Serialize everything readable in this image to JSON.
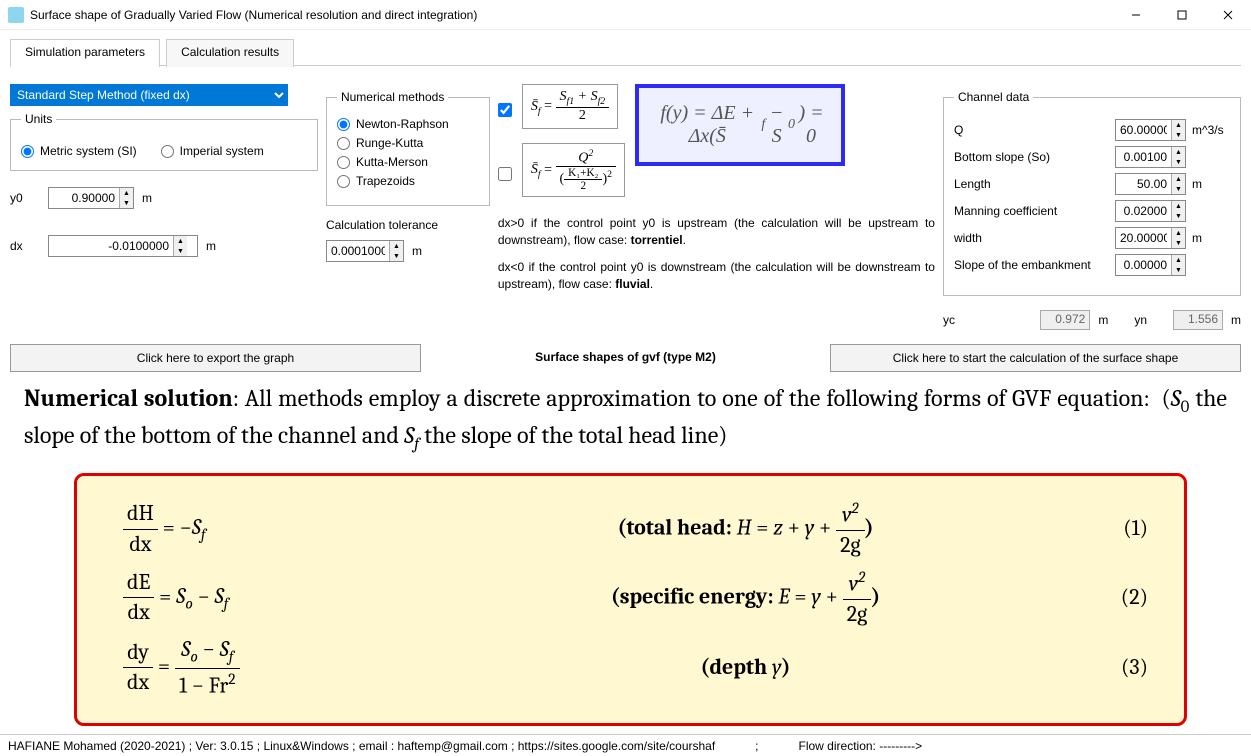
{
  "window": {
    "title": "Surface shape of Gradually Varied Flow (Numerical resolution and direct integration)"
  },
  "tabs": {
    "sim": "Simulation parameters",
    "results": "Calculation results"
  },
  "method_selected": "Standard Step Method (fixed dx)",
  "units": {
    "legend": "Units",
    "metric": "Metric system (SI)",
    "imperial": "Imperial system"
  },
  "num_methods": {
    "legend": "Numerical methods",
    "newton": "Newton-Raphson",
    "runge": "Runge-Kutta",
    "merson": "Kutta-Merson",
    "trap": "Trapezoids"
  },
  "params": {
    "y0_label": "y0",
    "y0_value": "0.90000",
    "y0_unit": "m",
    "dx_label": "dx",
    "dx_value": "-0.0100000",
    "dx_unit": "m",
    "tol_label": "Calculation tolerance",
    "tol_value": "0.0001000",
    "tol_unit": "m"
  },
  "formula1": "S̄_f = (S_f1 + S_f2) / 2",
  "formula2": "S̄_f = Q² / ((K₁+K₂)/2)²",
  "func": "f(y) = ΔE + Δx(S̄_f − S₀) = 0",
  "notes": {
    "line1a": "dx>0 if the control point y0 is upstream (the calculation will be upstream to downstream), flow case: ",
    "line1b": "torrentiel",
    "line2a": "dx<0 if the control point y0 is downstream (the calculation will be downstream to upstream), flow case: ",
    "line2b": "fluvial"
  },
  "channel": {
    "legend": "Channel data",
    "q_label": "Q",
    "q_value": "60.00000",
    "q_unit": "m^3/s",
    "so_label": "Bottom slope (So)",
    "so_value": "0.00100",
    "len_label": "Length",
    "len_value": "50.00",
    "len_unit": "m",
    "mann_label": "Manning coefficient",
    "mann_value": "0.02000",
    "w_label": "width",
    "w_value": "20.00000",
    "w_unit": "m",
    "emb_label": "Slope of the embankment",
    "emb_value": "0.00000",
    "yc_label": "yc",
    "yc_value": "0.972",
    "yc_unit": "m",
    "yn_label": "yn",
    "yn_value": "1.556",
    "yn_unit": "m"
  },
  "buttons": {
    "export": "Click here to export the graph",
    "title": "Surface shapes of gvf (type M2)",
    "start": "Click here to start the calculation of the surface shape"
  },
  "math": {
    "intro_b": "Numerical solution",
    "intro": ": All methods employ a discrete approximation to one of the following forms of GVF equation: (S₀ the slope of the bottom of the channel and S_f the slope of the total head line)",
    "eq1_lhs_n": "dH",
    "eq1_lhs_d": "dx",
    "eq1_rhs": " = −S_f",
    "eq1_desc_a": "(total head: ",
    "eq1_desc_b": "H = z + y + ",
    "eq1_frac_n": "v²",
    "eq1_frac_d": "2g",
    "eq1_desc_c": ")",
    "eq1_num": "(1)",
    "eq2_lhs_n": "dE",
    "eq2_lhs_d": "dx",
    "eq2_rhs": " = Sₒ − S_f",
    "eq2_desc_a": "(specific energy: ",
    "eq2_desc_b": "E = y + ",
    "eq2_desc_c": ")",
    "eq2_num": "(2)",
    "eq3_lhs_n": "dy",
    "eq3_lhs_d": "dx",
    "eq3_rhs_n": "Sₒ − S_f",
    "eq3_rhs_d": "1 − Fr²",
    "eq3_desc": "(depth y)",
    "eq3_num": "(3)"
  },
  "status": {
    "left": "HAFIANE Mohamed (2020-2021) ; Ver: 3.0.15 ; Linux&Windows ; email : haftemp@gmail.com ; https://sites.google.com/site/courshaf",
    "sep": ";",
    "right": "Flow direction: --------->"
  }
}
